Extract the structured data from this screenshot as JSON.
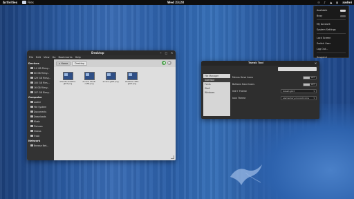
{
  "top_panel": {
    "activities": "Activities",
    "app_name": "Files",
    "clock": "Wed 23:28",
    "user": "aadmi"
  },
  "user_menu": {
    "items": [
      {
        "label": "Available",
        "toggle": true
      },
      {
        "label": "Busy",
        "toggle": true
      },
      {
        "label": "My Account"
      },
      {
        "label": "System Settings"
      },
      {
        "label": "Lock Screen"
      },
      {
        "label": "Switch User"
      },
      {
        "label": "Log Out..."
      },
      {
        "label": "Suspend"
      }
    ]
  },
  "file_manager": {
    "title": "Desktop",
    "menus": [
      "File",
      "Edit",
      "View",
      "Go",
      "Bookmarks",
      "Help"
    ],
    "sidebar": {
      "devices_header": "Devices",
      "devices": [
        "2.0 GB Filesy...",
        "60 GB Filesy...",
        "129 GB Filesy...",
        "100 GB Files...",
        "16 GB Filesy...",
        "107 GB Filesy..."
      ],
      "computer_header": "Computer",
      "computer": [
        "aadmi",
        "File System",
        "Documents",
        "Downloads",
        "Music",
        "Pictures",
        "Videos",
        "Trash"
      ],
      "network_header": "Network",
      "network": [
        "Browse Net..."
      ]
    },
    "breadcrumbs": [
      "Home",
      "Desktop"
    ],
    "files": [
      {
        "name": "advaita-shakthe-gtk3.png"
      },
      {
        "name": "Arcane Strait-caffe.png"
      },
      {
        "name": "arcane-gtk3.png"
      },
      {
        "name": "shakthe-caffe-gtk3.png"
      }
    ]
  },
  "tweak_tool": {
    "title": "Tweak Tool",
    "categories": [
      "File Manager",
      "Interface",
      "Fonts",
      "Shell",
      "Windows"
    ],
    "selected_category": "Interface",
    "options": [
      {
        "label": "Menus Have Icons",
        "value": "OFF"
      },
      {
        "label": "Buttons Have Icons",
        "value": "OFF"
      },
      {
        "label": "Gtk+ Theme",
        "value": "Kobalt-gtk3"
      },
      {
        "label": "Icon Theme",
        "value": "elementary-monochrome"
      }
    ]
  }
}
